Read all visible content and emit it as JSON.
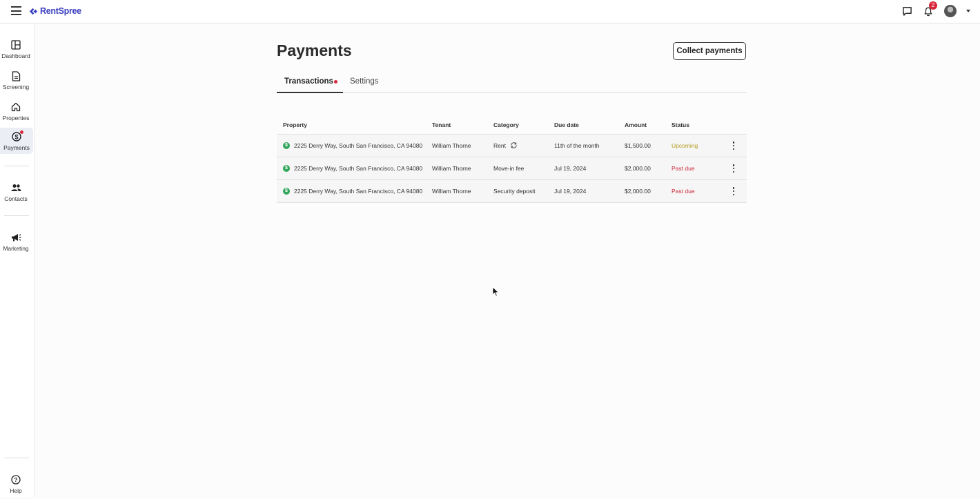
{
  "app": {
    "brand": "RentSpree",
    "brand_color": "#3a3fc0"
  },
  "topbar": {
    "notifications_count": "2"
  },
  "sidebar": {
    "items": [
      {
        "label": "Dashboard",
        "icon": "dashboard-icon"
      },
      {
        "label": "Screening",
        "icon": "document-icon"
      },
      {
        "label": "Properties",
        "icon": "home-icon"
      },
      {
        "label": "Payments",
        "icon": "dollar-icon",
        "active": true
      },
      {
        "label": "Contacts",
        "icon": "people-icon"
      },
      {
        "label": "Marketing",
        "icon": "megaphone-icon"
      }
    ],
    "help_label": "Help"
  },
  "page": {
    "title": "Payments",
    "collect_button": "Collect payments"
  },
  "tabs": {
    "transactions": "Transactions",
    "settings": "Settings"
  },
  "table": {
    "headers": {
      "property": "Property",
      "tenant": "Tenant",
      "category": "Category",
      "due_date": "Due date",
      "amount": "Amount",
      "status": "Status"
    },
    "rows": [
      {
        "property": "2225 Derry Way, South San Francisco, CA 94080",
        "tenant": "William Thorne",
        "category": "Rent",
        "due_date": "11th of the month",
        "amount": "$1,500.00",
        "status": "Upcoming"
      },
      {
        "property": "2225 Derry Way, South San Francisco, CA 94080",
        "tenant": "William Thorne",
        "category": "Move-in fee",
        "due_date": "Jul 19, 2024",
        "amount": "$2,000.00",
        "status": "Past due"
      },
      {
        "property": "2225 Derry Way, South San Francisco, CA 94080",
        "tenant": "William Thorne",
        "category": "Security deposit",
        "due_date": "Jul 19, 2024",
        "amount": "$2,000.00",
        "status": "Past due"
      }
    ]
  },
  "colors": {
    "upcoming": "#b49b1e",
    "past_due": "#c8293c",
    "paid_icon": "#2fa65a",
    "alert_dot": "#d8293c"
  }
}
